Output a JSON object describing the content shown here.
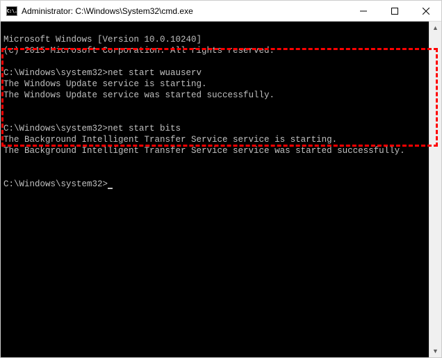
{
  "titlebar": {
    "icon_text": "C:\\.",
    "title": "Administrator: C:\\Windows\\System32\\cmd.exe"
  },
  "terminal": {
    "header_line1": "Microsoft Windows [Version 10.0.10240]",
    "header_line2": "(c) 2015 Microsoft Corporation. All rights reserved.",
    "block1": {
      "prompt": "C:\\Windows\\system32>",
      "command": "net start wuauserv",
      "out1": "The Windows Update service is starting.",
      "out2": "The Windows Update service was started successfully."
    },
    "block2": {
      "prompt": "C:\\Windows\\system32>",
      "command": "net start bits",
      "out1": "The Background Intelligent Transfer Service service is starting.",
      "out2": "The Background Intelligent Transfer Service service was started successfully."
    },
    "prompt_current": "C:\\Windows\\system32>"
  }
}
